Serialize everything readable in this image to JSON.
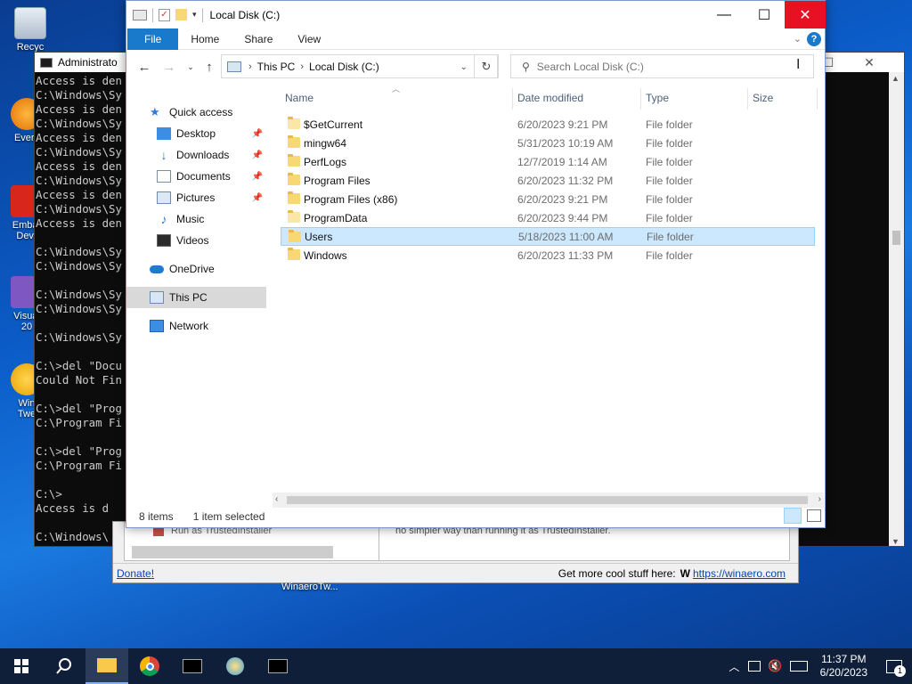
{
  "desktop": {
    "icons": [
      {
        "label": "Recyc",
        "name": "recycle-bin"
      },
      {
        "label": "Every",
        "name": "everything"
      },
      {
        "label": "Embar",
        "label2": "Dev-",
        "name": "embarcadero-dev-cpp"
      },
      {
        "label": "Visual",
        "label2": "20",
        "name": "visual-studio"
      },
      {
        "label": "Win",
        "label2": "Twe",
        "name": "winaero-tweaker"
      }
    ]
  },
  "console": {
    "title": "Administrato",
    "lines": "Access is den\nC:\\Windows\\Sy\nAccess is den\nC:\\Windows\\Sy\nAccess is den\nC:\\Windows\\Sy\nAccess is den\nC:\\Windows\\Sy\nAccess is den\nC:\\Windows\\Sy\nAccess is den\n\nC:\\Windows\\Sy\nC:\\Windows\\Sy\n\nC:\\Windows\\Sy\nC:\\Windows\\Sy\n\nC:\\Windows\\Sy\n\nC:\\>del \"Docu\nCould Not Fin\n\nC:\\>del \"Prog\nC:\\Program Fi\n\nC:\\>del \"Prog\nC:\\Program Fi\n\nC:\\>\nAccess is d\n\nC:\\Windows\\"
  },
  "winaero": {
    "run_as_item": "Run as TrustedInstaller",
    "desc_text": "no simpler way than running it as TrustedInstaller.",
    "donate": "Donate!",
    "more_stuff": "Get more cool stuff here:",
    "w_mark": "W",
    "link": "https://winaero.com",
    "desktop_label": "WinaeroTw..."
  },
  "explorer": {
    "title": "Local Disk (C:)",
    "tabs": [
      "File",
      "Home",
      "Share",
      "View"
    ],
    "breadcrumb": [
      "This PC",
      "Local Disk (C:)"
    ],
    "search_placeholder": "Search Local Disk (C:)",
    "nav": [
      {
        "label": "Quick access",
        "icon": "star-icon",
        "pinned": false
      },
      {
        "label": "Desktop",
        "icon": "desktop-folder-icon",
        "pinned": true
      },
      {
        "label": "Downloads",
        "icon": "download-arrow-icon",
        "pinned": true
      },
      {
        "label": "Documents",
        "icon": "documents-icon",
        "pinned": true
      },
      {
        "label": "Pictures",
        "icon": "pictures-icon",
        "pinned": true
      },
      {
        "label": "Music",
        "icon": "music-note-icon",
        "pinned": false
      },
      {
        "label": "Videos",
        "icon": "video-icon",
        "pinned": false
      },
      {
        "label": "OneDrive",
        "icon": "cloud-icon",
        "pinned": false
      },
      {
        "label": "This PC",
        "icon": "computer-icon",
        "pinned": false,
        "selected": true
      },
      {
        "label": "Network",
        "icon": "network-icon",
        "pinned": false
      }
    ],
    "columns": [
      "Name",
      "Date modified",
      "Type",
      "Size"
    ],
    "files": [
      {
        "name": "$GetCurrent",
        "date": "6/20/2023 9:21 PM",
        "type": "File folder",
        "light": true
      },
      {
        "name": "mingw64",
        "date": "5/31/2023 10:19 AM",
        "type": "File folder"
      },
      {
        "name": "PerfLogs",
        "date": "12/7/2019 1:14 AM",
        "type": "File folder"
      },
      {
        "name": "Program Files",
        "date": "6/20/2023 11:32 PM",
        "type": "File folder"
      },
      {
        "name": "Program Files (x86)",
        "date": "6/20/2023 9:21 PM",
        "type": "File folder"
      },
      {
        "name": "ProgramData",
        "date": "6/20/2023 9:44 PM",
        "type": "File folder",
        "light": true
      },
      {
        "name": "Users",
        "date": "5/18/2023 11:00 AM",
        "type": "File folder",
        "selected": true
      },
      {
        "name": "Windows",
        "date": "6/20/2023 11:33 PM",
        "type": "File folder"
      }
    ],
    "status_count": "8 items",
    "status_selected": "1 item selected"
  },
  "taskbar": {
    "time": "11:37 PM",
    "date": "6/20/2023",
    "notification_count": "1"
  },
  "colors": {
    "file_tab": "#1979ca",
    "close_button": "#e81123",
    "selection": "#cce8ff",
    "taskbar": "#0f1f3a"
  }
}
